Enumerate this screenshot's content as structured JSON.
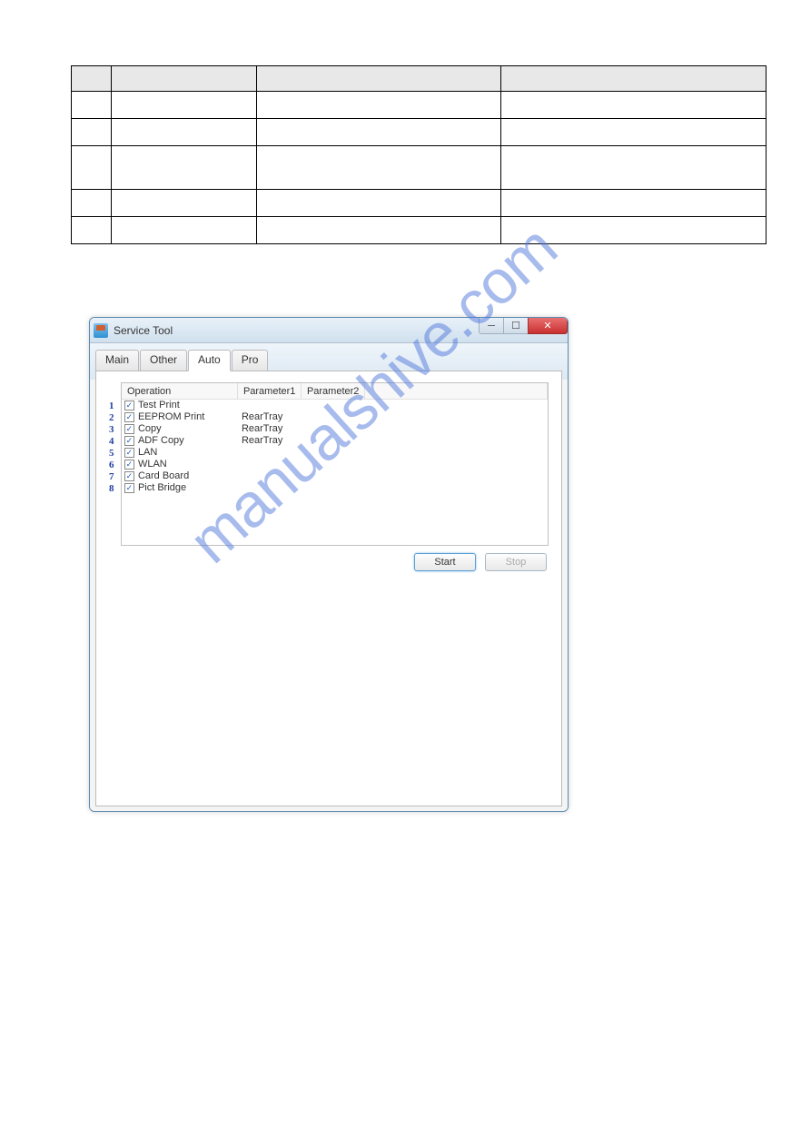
{
  "window": {
    "title": "Service Tool"
  },
  "tabs": {
    "main": "Main",
    "other": "Other",
    "auto": "Auto",
    "pro": "Pro"
  },
  "list": {
    "headers": {
      "operation": "Operation",
      "param1": "Parameter1",
      "param2": "Parameter2"
    },
    "rows": [
      {
        "n": "1",
        "op": "Test Print",
        "p1": "",
        "p2": "",
        "checked": true
      },
      {
        "n": "2",
        "op": "EEPROM Print",
        "p1": "RearTray",
        "p2": "",
        "checked": true
      },
      {
        "n": "3",
        "op": "Copy",
        "p1": "RearTray",
        "p2": "",
        "checked": true
      },
      {
        "n": "4",
        "op": "ADF Copy",
        "p1": "RearTray",
        "p2": "",
        "checked": true
      },
      {
        "n": "5",
        "op": "LAN",
        "p1": "",
        "p2": "",
        "checked": true
      },
      {
        "n": "6",
        "op": "WLAN",
        "p1": "",
        "p2": "",
        "checked": true
      },
      {
        "n": "7",
        "op": "Card Board",
        "p1": "",
        "p2": "",
        "checked": true
      },
      {
        "n": "8",
        "op": "Pict Bridge",
        "p1": "",
        "p2": "",
        "checked": true
      }
    ]
  },
  "buttons": {
    "start": "Start",
    "stop": "Stop"
  },
  "watermark": "manualshive.com"
}
